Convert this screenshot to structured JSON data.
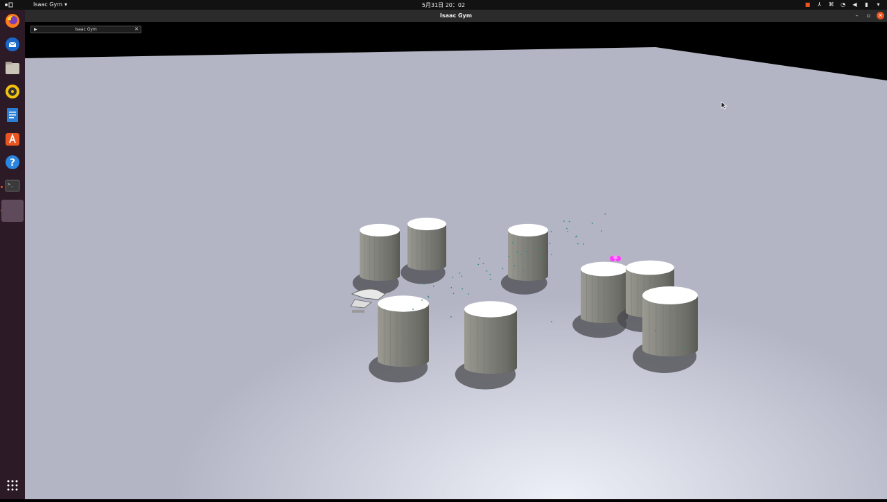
{
  "topbar": {
    "app_menu_label": "Isaac Gym",
    "clock": "5月31日 20：02",
    "tray_icons": [
      "camera-icon",
      "accessibility-icon",
      "network-icon",
      "wifi-icon",
      "volume-icon",
      "battery-icon",
      "power-menu-icon"
    ]
  },
  "dock": {
    "items": [
      {
        "name": "firefox-icon"
      },
      {
        "name": "thunderbird-icon"
      },
      {
        "name": "files-icon"
      },
      {
        "name": "rhythmbox-icon"
      },
      {
        "name": "writer-icon"
      },
      {
        "name": "software-icon"
      },
      {
        "name": "help-icon"
      },
      {
        "name": "terminal-icon"
      },
      {
        "name": "isaac-gym-app-icon"
      }
    ],
    "show_apps": "apps-grid-icon"
  },
  "window": {
    "title": "Isaac Gym",
    "panel_title": "Isaac Gym"
  },
  "colors": {
    "ground": "#b4b6c6",
    "cylinder_side": "#808078",
    "cylinder_top": "#ffffff",
    "accent": "#e95420",
    "target_marker": "#ff3cff"
  }
}
